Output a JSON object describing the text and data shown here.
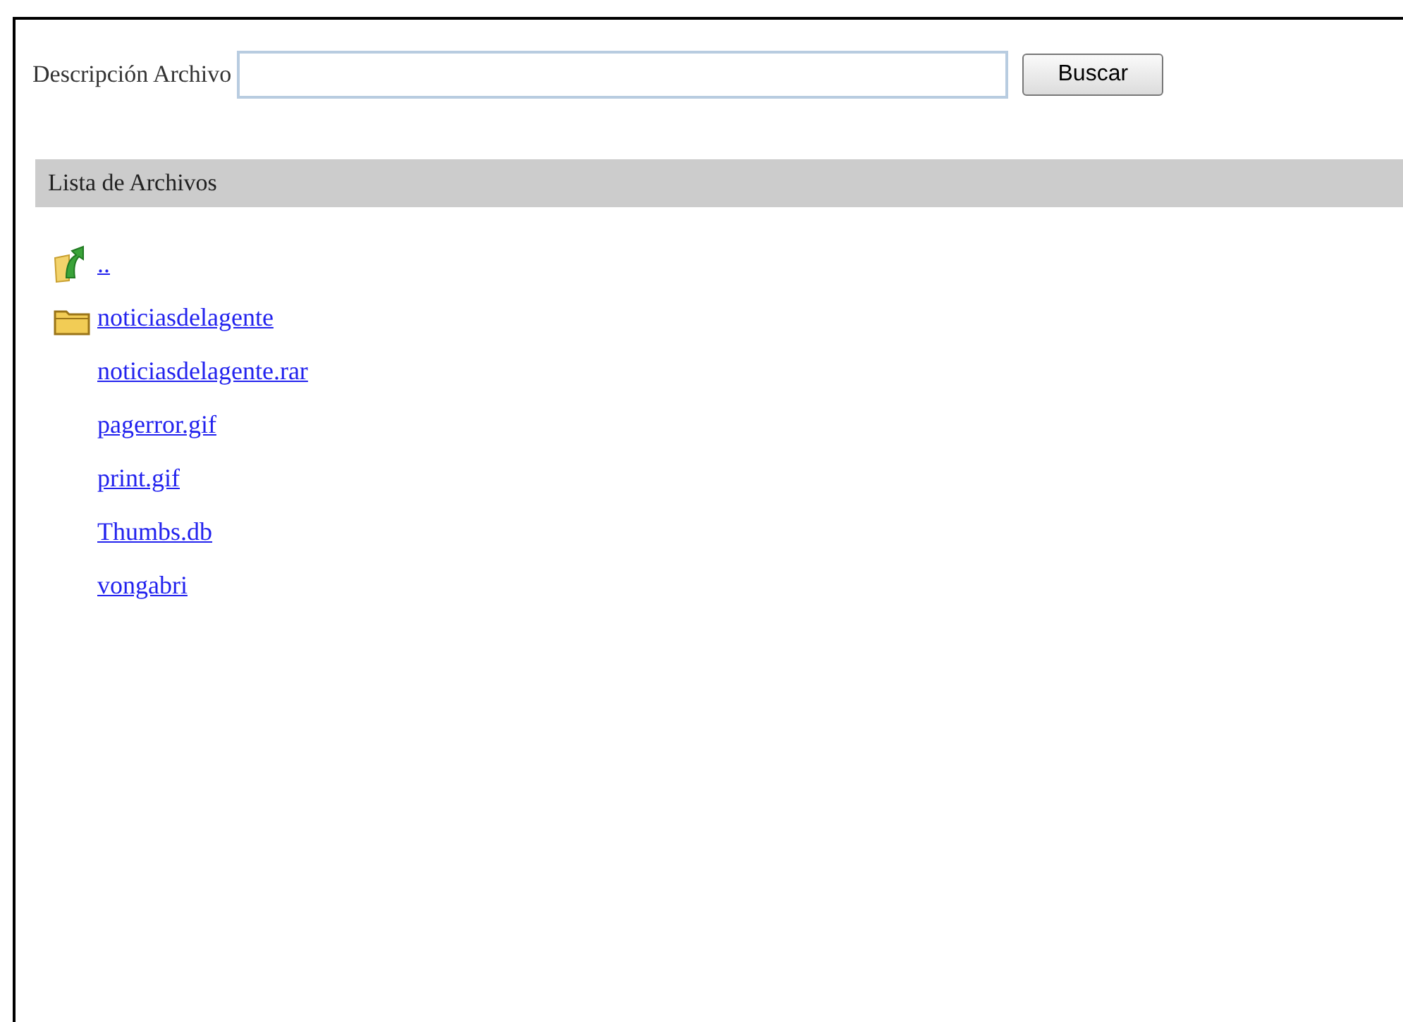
{
  "search": {
    "label": "Descripción Archivo",
    "button": "Buscar"
  },
  "list": {
    "title": "Lista de Archivos",
    "items": [
      {
        "kind": "up",
        "name": ".."
      },
      {
        "kind": "folder",
        "name": "noticiasdelagente"
      },
      {
        "kind": "file",
        "name": "noticiasdelagente.rar"
      },
      {
        "kind": "file",
        "name": "pagerror.gif"
      },
      {
        "kind": "file",
        "name": "print.gif"
      },
      {
        "kind": "file",
        "name": "Thumbs.db"
      },
      {
        "kind": "file",
        "name": "vongabri"
      }
    ]
  }
}
